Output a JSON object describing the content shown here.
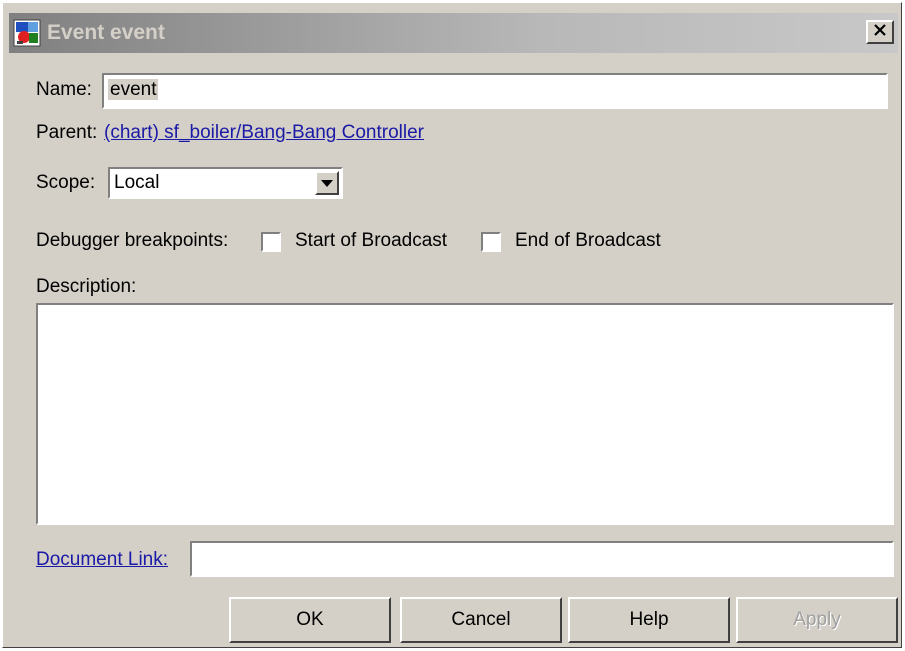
{
  "window": {
    "title": "Event event",
    "close_glyph": "×"
  },
  "name": {
    "label": "Name:",
    "value": "event"
  },
  "parent": {
    "label": "Parent:",
    "link_text": "(chart) sf_boiler/Bang-Bang Controller"
  },
  "scope": {
    "label": "Scope:",
    "selected": "Local"
  },
  "breakpoints": {
    "label": "Debugger breakpoints:",
    "start_label": "Start of Broadcast",
    "start_checked": false,
    "end_label": "End of Broadcast",
    "end_checked": false
  },
  "description": {
    "label": "Description:",
    "value": ""
  },
  "document_link": {
    "label": "Document Link:",
    "value": ""
  },
  "buttons": {
    "ok": "OK",
    "cancel": "Cancel",
    "help": "Help",
    "apply": "Apply"
  },
  "colors": {
    "dialog_bg": "#d4d0c8",
    "link": "#1a1aa6",
    "title_text": "#d4d0c8",
    "disabled_text": "#a0a0a0"
  },
  "icons": {
    "title": "stateflow-event-icon",
    "close": "close-icon",
    "dropdown": "dropdown-arrow-icon"
  }
}
